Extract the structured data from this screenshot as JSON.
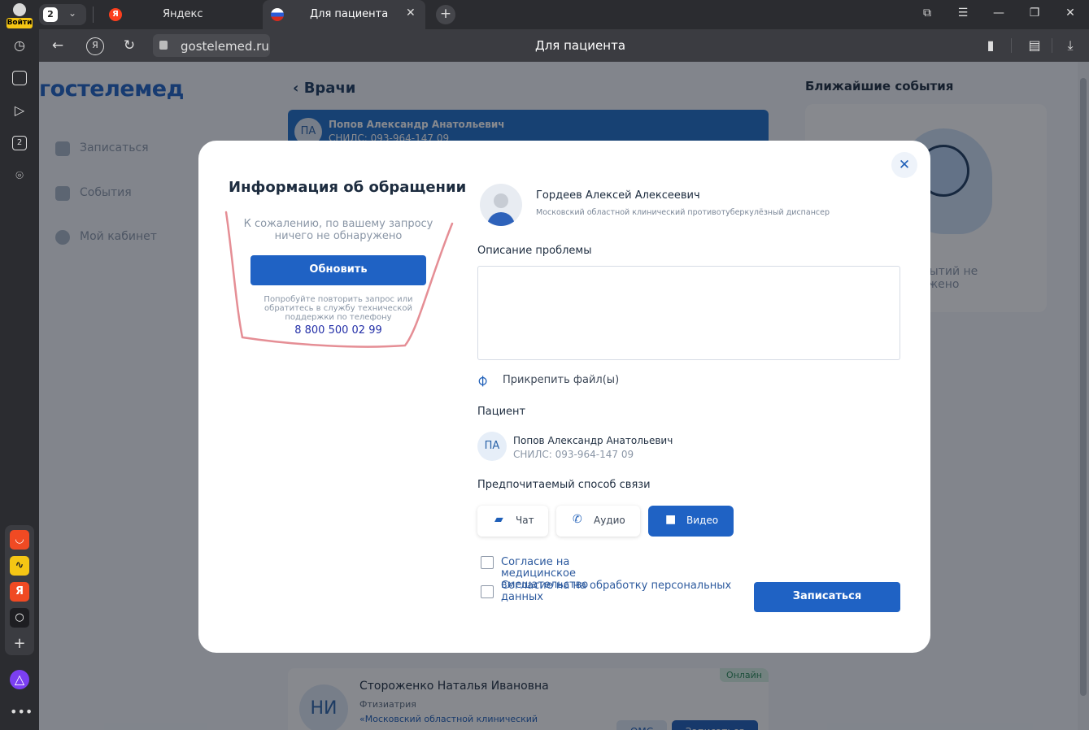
{
  "browser": {
    "login_label": "Войти",
    "tab_count": "2",
    "tabs": [
      {
        "title": "Яндекс",
        "favicon": "Я"
      },
      {
        "title": "Для пациента"
      }
    ],
    "url": "gostelemed.ru",
    "page_title": "Для пациента",
    "sidebar_counter": "2"
  },
  "site": {
    "logo": "гостелемед",
    "nav": [
      {
        "label": "Записаться",
        "icon": "plus-icon"
      },
      {
        "label": "События",
        "icon": "document-icon"
      },
      {
        "label": "Мой кабинет",
        "icon": "gear-icon"
      }
    ],
    "doctors_heading": "Врачи",
    "top_card": {
      "initials": "ПА",
      "name": "Попов Александр Анатольевич",
      "snils": "СНИЛС: 093-964-147 09"
    },
    "events_title": "Ближайшие события",
    "events_empty": "событий не\nжено",
    "bottom_card": {
      "badge": "Онлайн",
      "initials": "НИ",
      "name": "Стороженко Наталья Ивановна",
      "specialty": "Фтизиатрия",
      "org": "«Московский областной клинический",
      "oms": "ОМС",
      "book": "Записаться"
    }
  },
  "modal": {
    "title": "Информация об обращении",
    "nothing_found": "К сожалению, по вашему запросу ничего не обнаружено",
    "refresh_label": "Обновить",
    "hint": "Попробуйте повторить запрос или обратитесь в службу технической поддержки по телефону",
    "phone": "8 800 500 02 99",
    "doctor": {
      "name": "Гордеев Алексей Алексеевич",
      "org": "Московский областной клинический противотуберкулёзный диспансер"
    },
    "problem_label": "Описание проблемы",
    "problem_value": "",
    "attach_label": "Прикрепить файл(ы)",
    "patient_label": "Пациент",
    "patient": {
      "initials": "ПА",
      "name": "Попов Александр Анатольевич",
      "snils": "СНИЛС: 093-964-147 09"
    },
    "contact_label": "Предпочитаемый способ связи",
    "contact_options": [
      {
        "label": "Чат",
        "icon": "chat-icon",
        "selected": false
      },
      {
        "label": "Аудио",
        "icon": "phone-icon",
        "selected": false
      },
      {
        "label": "Видео",
        "icon": "video-camera-icon",
        "selected": true
      }
    ],
    "consents": [
      {
        "label": "Согласие на медицинское вмешательство",
        "checked": false
      },
      {
        "label": "Согласие на на обработку персональных данных",
        "checked": false
      }
    ],
    "submit_label": "Записаться",
    "colors": {
      "primary": "#1f62c4",
      "scribble": "#e07a82"
    }
  }
}
